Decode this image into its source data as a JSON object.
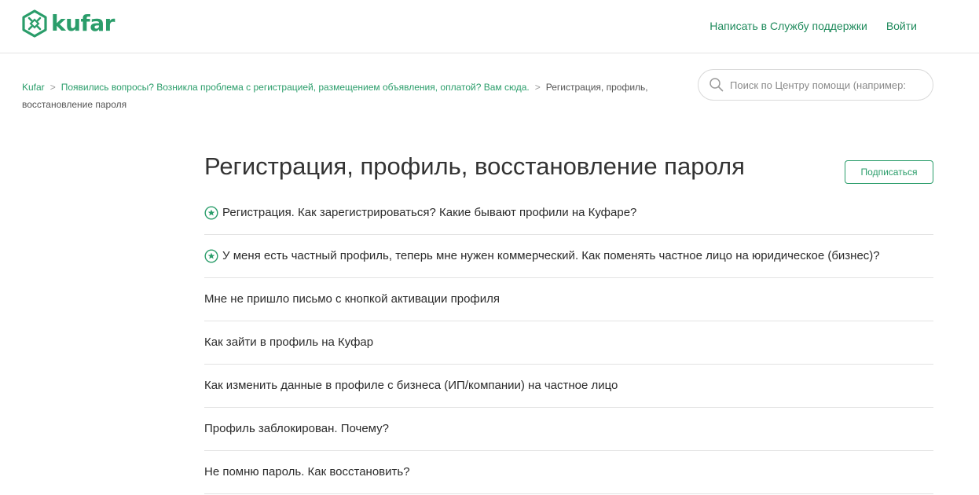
{
  "header": {
    "logo_text": "kufar",
    "nav": {
      "support": "Написать в Службу поддержки",
      "login": "Войти"
    }
  },
  "breadcrumbs": {
    "home": "Kufar",
    "section": "Появились вопросы? Возникла проблема с регистрацией, размещением объявления, оплатой? Вам сюда.",
    "current": "Регистрация, профиль, восстановление пароля"
  },
  "search": {
    "placeholder": "Поиск по Центру помощи (например:"
  },
  "page": {
    "title": "Регистрация, профиль, восстановление пароля",
    "subscribe_label": "Подписаться"
  },
  "articles": [
    {
      "title": "Регистрация. Как зарегистрироваться? Какие бывают профили на Куфаре?",
      "promoted": true,
      "icon": "star-icon"
    },
    {
      "title": "У меня есть частный профиль, теперь мне нужен коммерческий. Как поменять частное лицо на юридическое (бизнес)?",
      "promoted": true,
      "icon": "star-icon"
    },
    {
      "title": "Мне не пришло письмо с кнопкой активации профиля",
      "promoted": false
    },
    {
      "title": "Как зайти в профиль на Куфар",
      "promoted": false
    },
    {
      "title": "Как изменить данные в профиле с бизнеса (ИП/компании) на частное лицо",
      "promoted": false
    },
    {
      "title": "Профиль заблокирован. Почему?",
      "promoted": false
    },
    {
      "title": "Не помню пароль. Как восстановить?",
      "promoted": false
    }
  ],
  "colors": {
    "brand_green": "#2a9d6a",
    "link_green": "#1f8a5c",
    "divider": "#e3e3e3"
  }
}
